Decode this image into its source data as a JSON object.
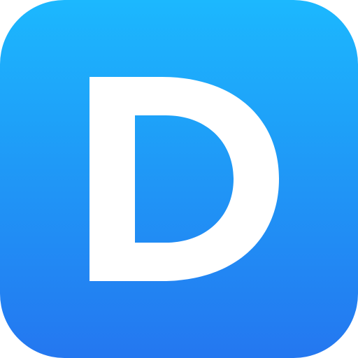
{
  "icon": {
    "letter": "D",
    "glyph_icon": "letter-d-icon",
    "colors": {
      "gradient_top": "#1cb8fe",
      "gradient_mid": "#1f9af7",
      "gradient_bottom": "#2477f0",
      "glyph": "#ffffff"
    }
  }
}
